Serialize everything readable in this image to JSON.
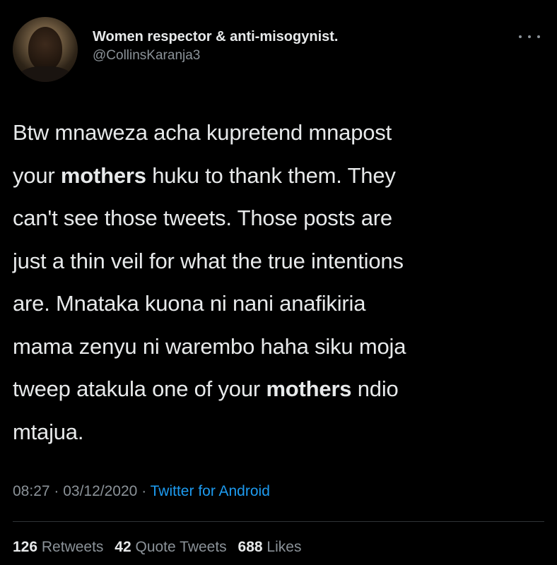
{
  "author": {
    "display_name": "Women respector & anti-misogynist.",
    "handle": "@CollinsKaranja3"
  },
  "more_icon": "more-horizontal-icon",
  "tweet": {
    "lines": [
      [
        {
          "text": "Btw mnaweza acha kupretend mnapost"
        }
      ],
      [
        {
          "text": "your "
        },
        {
          "text": "mothers",
          "bold": true
        },
        {
          "text": " huku to thank them. They"
        }
      ],
      [
        {
          "text": "can't see those tweets. Those posts are"
        }
      ],
      [
        {
          "text": "just a thin veil for what the true intentions"
        }
      ],
      [
        {
          "text": "are. Mnataka kuona ni nani anafikiria"
        }
      ],
      [
        {
          "text": "mama zenyu ni warembo haha siku moja"
        }
      ],
      [
        {
          "text": "tweep atakula one of your "
        },
        {
          "text": "mothers",
          "bold": true
        },
        {
          "text": " ndio"
        }
      ],
      [
        {
          "text": "mtajua."
        }
      ]
    ]
  },
  "meta": {
    "time": "08:27",
    "separator": "·",
    "date": "03/12/2020",
    "source": "Twitter for Android"
  },
  "stats": {
    "retweets_count": "126",
    "retweets_label": "Retweets",
    "quotes_count": "42",
    "quotes_label": "Quote Tweets",
    "likes_count": "688",
    "likes_label": "Likes"
  },
  "colors": {
    "background": "#000000",
    "text": "#e7e9ea",
    "secondary": "#8b9298",
    "link": "#1d9bf0"
  }
}
